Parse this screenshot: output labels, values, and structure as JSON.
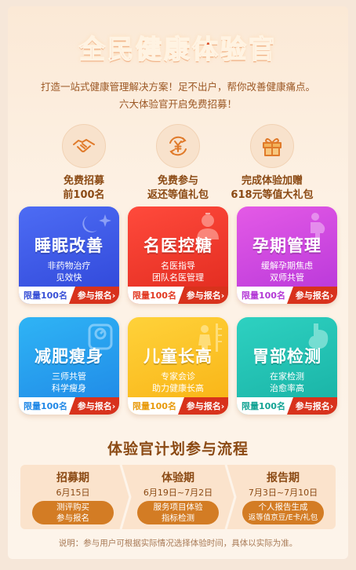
{
  "header": {
    "title": "全民健康体验官",
    "intro_line1": "打造一站式健康管理解决方案！足不出户，帮你改善健康痛点。",
    "intro_line2": "六大体验官开启免费招募！"
  },
  "benefits": [
    {
      "icon": "handshake-icon",
      "line1": "免费招募",
      "line2": "前100名"
    },
    {
      "icon": "yen-refund-icon",
      "line1": "免费参与",
      "line2": "返还等值礼包"
    },
    {
      "icon": "gift-icon",
      "line1": "完成体验加赠",
      "line2": "618元等值大礼包"
    }
  ],
  "cards": [
    {
      "name": "睡眠改善",
      "desc1": "非药物治疗",
      "desc2": "见效快",
      "limit": "限量100名",
      "join": "参与报名›"
    },
    {
      "name": "名医控糖",
      "desc1": "名医指导",
      "desc2": "团队名医管理",
      "limit": "限量100名",
      "join": "参与报名›"
    },
    {
      "name": "孕期管理",
      "desc1": "缓解孕期焦虑",
      "desc2": "双师共管",
      "limit": "限量100名",
      "join": "参与报名›"
    },
    {
      "name": "减肥瘦身",
      "desc1": "三师共管",
      "desc2": "科学瘦身",
      "limit": "限量100名",
      "join": "参与报名›"
    },
    {
      "name": "儿童长高",
      "desc1": "专家会诊",
      "desc2": "助力健康长高",
      "limit": "限量100名",
      "join": "参与报名›"
    },
    {
      "name": "胃部检测",
      "desc1": "在家检测",
      "desc2": "治愈率高",
      "limit": "限量100名",
      "join": "参与报名›"
    }
  ],
  "flow": {
    "title": "体验官计划参与流程",
    "steps": [
      {
        "name": "招募期",
        "date": "6月15日",
        "action1": "测评购买",
        "action2": "参与报名"
      },
      {
        "name": "体验期",
        "date": "6月19日~7月2日",
        "action1": "服务项目体验",
        "action2": "指标检测"
      },
      {
        "name": "报告期",
        "date": "7月3日~7月10日",
        "action1": "个人报告生成",
        "action2": "返等值京豆/E卡/礼包"
      }
    ]
  },
  "note": "说明：参与用户可根据实际情况选择体验时间，具体以实际为准。",
  "colors": {
    "title": "#d9471e",
    "sleep": "#2f46d8",
    "sugar": "#e02a1e",
    "pregnancy": "#b636d9",
    "slim": "#1f87e6",
    "child": "#f8b214",
    "stomach": "#18b1a4",
    "join_button": "#d8321c",
    "flow_pill": "#d37c24"
  }
}
